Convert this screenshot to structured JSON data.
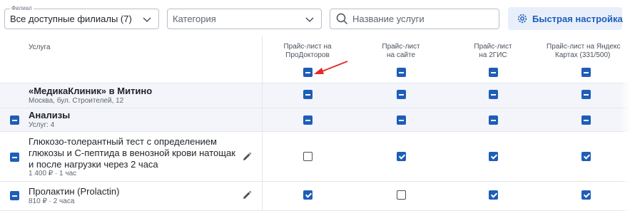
{
  "toolbar": {
    "branch": {
      "legend": "Филиал",
      "value": "Все доступные филиалы (7)"
    },
    "category": {
      "placeholder": "Категория"
    },
    "search": {
      "placeholder": "Название услуги"
    },
    "quick_setup_label": "Быстрая настройка"
  },
  "header": {
    "service": "Услуга",
    "columns": [
      {
        "line1": "Прайс-лист на",
        "line2": "ПроДокторов",
        "state": "indeterminate"
      },
      {
        "line1": "Прайс-лист",
        "line2": "на сайте",
        "state": "indeterminate"
      },
      {
        "line1": "Прайс-лист",
        "line2": "на 2ГИС",
        "state": "indeterminate"
      },
      {
        "line1": "Прайс-лист на Яндекс",
        "line2": "Картах (331/500)",
        "state": "indeterminate"
      }
    ]
  },
  "rows": [
    {
      "title": "«МедикаКлиник» в Митино",
      "sub": "Москва, бул. Строителей, 12",
      "states": [
        "indeterminate",
        "indeterminate",
        "indeterminate",
        "indeterminate"
      ]
    },
    {
      "title": "Анализы",
      "sub": "Услуг: 4",
      "row_checkbox": "indeterminate",
      "states": [
        "indeterminate",
        "indeterminate",
        "indeterminate",
        "indeterminate"
      ]
    },
    {
      "title_lines": [
        "Глюкозо-толерантный тест с определением",
        "глюкозы и С-пептида в венозной крови натощак",
        "и после нагрузки через 2 часа"
      ],
      "sub": "1 400 ₽ · 1 час",
      "row_checkbox": "indeterminate",
      "states": [
        "unchecked",
        "checked",
        "checked",
        "checked"
      ]
    },
    {
      "title": "Пролактин (Prolactin)",
      "sub": "810 ₽ · 2 часа",
      "row_checkbox": "indeterminate",
      "states": [
        "checked",
        "unchecked",
        "checked",
        "checked"
      ]
    }
  ],
  "colors": {
    "accent": "#1e5eb8",
    "quick_bg": "#e8effa",
    "row_tint": "#f3f5fa",
    "arrow": "#e52b2b"
  }
}
